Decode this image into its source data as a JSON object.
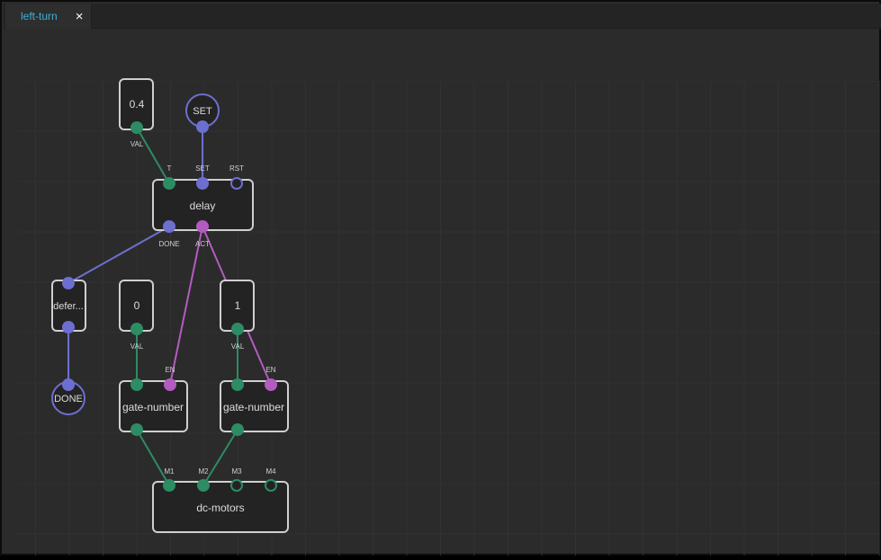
{
  "tab": {
    "label": "left-turn",
    "close_glyph": "×"
  },
  "colors": {
    "background": "#2b2b2b",
    "node_fill": "#232323",
    "node_border": "#cfcfcf",
    "pin_number": "#2d8c63",
    "pin_pulse": "#6d6fd0",
    "link_enable": "#b35cc0",
    "tab_text": "#3fb1d6"
  },
  "nodes": {
    "const_val_04": {
      "value": "0.4",
      "out_pin": "VAL"
    },
    "set_terminal": {
      "label": "SET"
    },
    "delay": {
      "label": "delay",
      "pins_in": [
        "T",
        "SET",
        "RST"
      ],
      "pins_out": [
        "DONE",
        "ACT"
      ]
    },
    "defer": {
      "label": "defer..."
    },
    "done_terminal": {
      "label": "DONE"
    },
    "const_val_0": {
      "value": "0",
      "out_pin": "VAL"
    },
    "const_val_1": {
      "value": "1",
      "out_pin": "VAL"
    },
    "gate_number_1": {
      "label": "gate-number",
      "pin_en": "EN"
    },
    "gate_number_2": {
      "label": "gate-number",
      "pin_en": "EN"
    },
    "dc_motors": {
      "label": "dc-motors",
      "pins_in": [
        "M1",
        "M2",
        "M3",
        "M4"
      ]
    }
  }
}
